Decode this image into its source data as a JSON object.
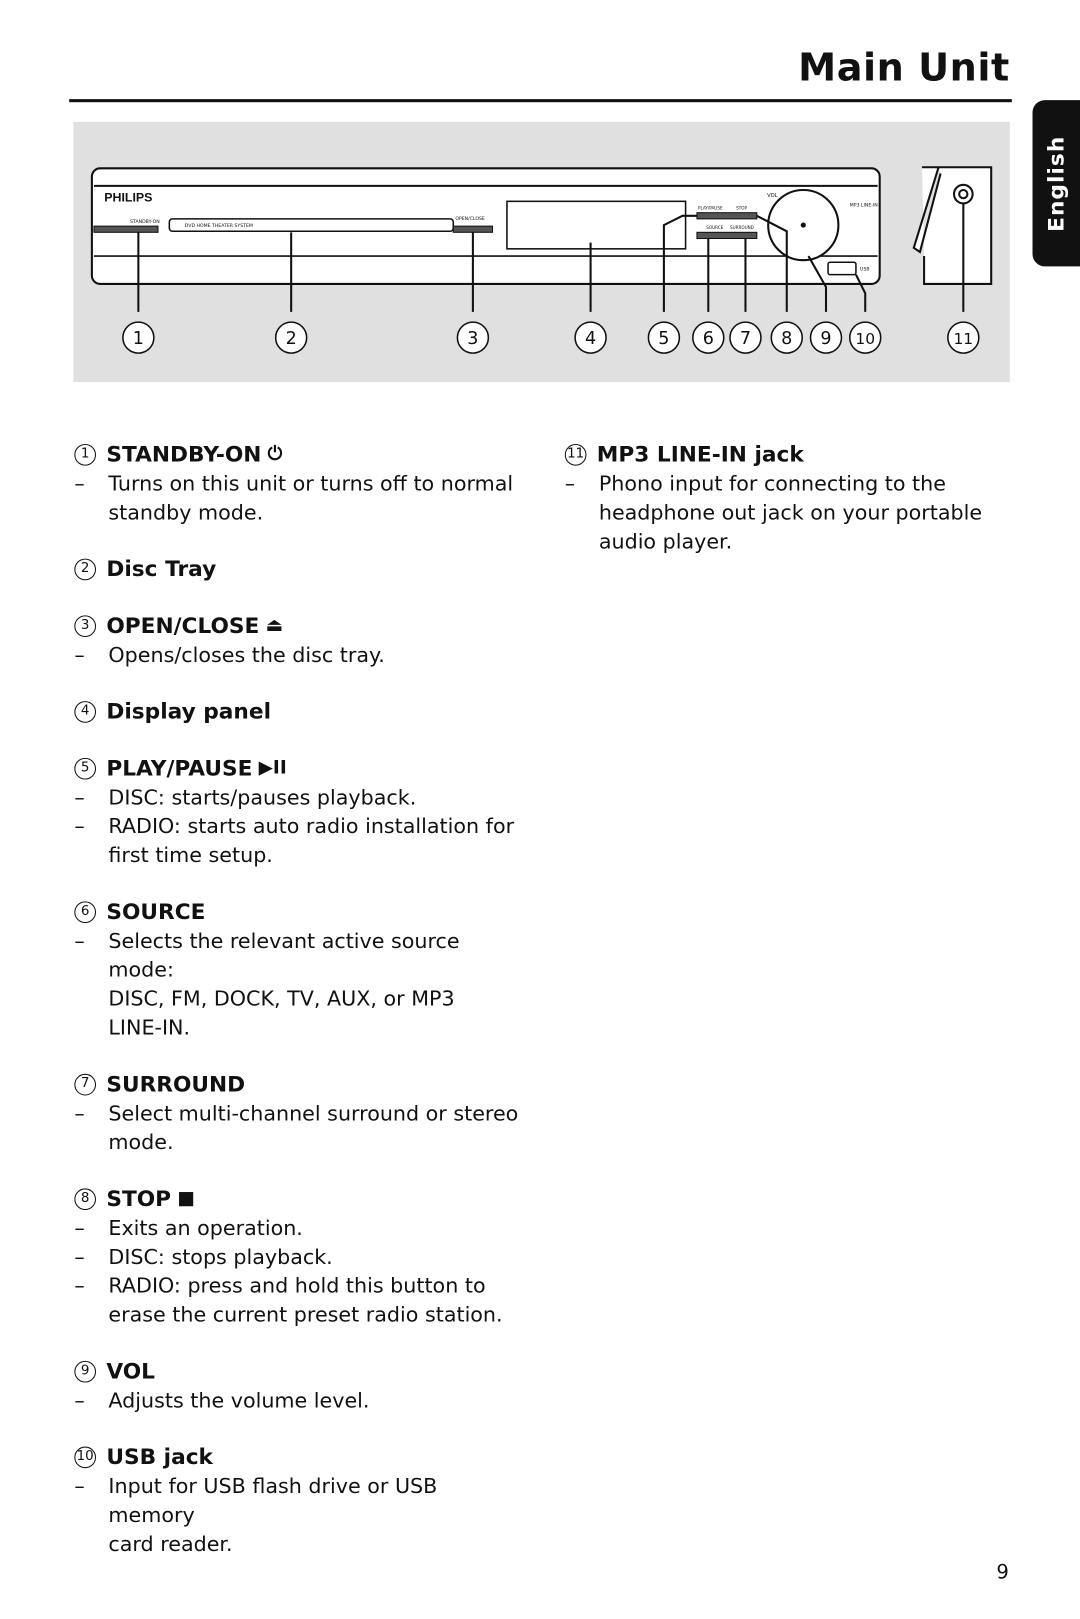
{
  "header": {
    "title": "Main Unit",
    "language_tab": "English"
  },
  "diagram": {
    "brand": "PHILIPS",
    "device_labels": [
      "STANDBY-ON",
      "DVD HOME THEATER SYSTEM",
      "OPEN/CLOSE",
      "PLAY/PAUSE",
      "STOP",
      "SOURCE",
      "SURROUND",
      "VOL",
      "MP3 LINE-IN",
      "USB"
    ],
    "callouts": [
      "1",
      "2",
      "3",
      "4",
      "5",
      "6",
      "7",
      "8",
      "9",
      "10",
      "11"
    ],
    "background_color": "#e0e0e0"
  },
  "entries": [
    {
      "num": "1",
      "title": "STANDBY-ON",
      "icon": "power-icon",
      "glyph": "⏻",
      "lines": [
        "Turns on this unit or turns off to normal",
        "standby mode."
      ],
      "dashes": [
        true,
        false
      ]
    },
    {
      "num": "2",
      "title": "Disc Tray",
      "lines": [],
      "dashes": []
    },
    {
      "num": "3",
      "title": "OPEN/CLOSE",
      "icon": "eject-icon",
      "glyph": "⏏",
      "lines": [
        "Opens/closes the disc tray."
      ],
      "dashes": [
        true
      ]
    },
    {
      "num": "4",
      "title": "Display panel",
      "lines": [],
      "dashes": []
    },
    {
      "num": "5",
      "title": "PLAY/PAUSE",
      "icon": "play-pause-icon",
      "glyph": "▶II",
      "lines": [
        "DISC: starts/pauses playback.",
        "RADIO: starts auto radio installation for",
        "first time setup."
      ],
      "dashes": [
        true,
        true,
        false
      ]
    },
    {
      "num": "6",
      "title": "SOURCE",
      "lines": [
        "Selects the relevant active source mode:",
        "DISC, FM, DOCK, TV, AUX,  or MP3",
        "LINE-IN."
      ],
      "dashes": [
        true,
        false,
        false
      ]
    },
    {
      "num": "7",
      "title": "SURROUND",
      "lines": [
        "Select multi-channel surround or stereo",
        "mode."
      ],
      "dashes": [
        true,
        false
      ]
    },
    {
      "num": "8",
      "title": "STOP",
      "icon": "stop-icon",
      "glyph": "■",
      "lines": [
        "Exits an operation.",
        "DISC: stops playback.",
        "RADIO: press and hold this button to",
        "erase the current preset radio station."
      ],
      "dashes": [
        true,
        true,
        true,
        false
      ]
    },
    {
      "num": "9",
      "title": "VOL",
      "lines": [
        "Adjusts the volume level."
      ],
      "dashes": [
        true
      ]
    },
    {
      "num": "10",
      "title": "USB jack",
      "lines": [
        "Input for USB flash drive or USB memory",
        "card reader."
      ],
      "dashes": [
        true,
        false
      ]
    },
    {
      "num": "11",
      "title": "MP3 LINE-IN jack",
      "lines": [
        "Phono input for connecting to the",
        "headphone out jack on your portable",
        "audio player."
      ],
      "dashes": [
        true,
        false,
        false
      ]
    }
  ],
  "footer": {
    "page_number": "9"
  }
}
